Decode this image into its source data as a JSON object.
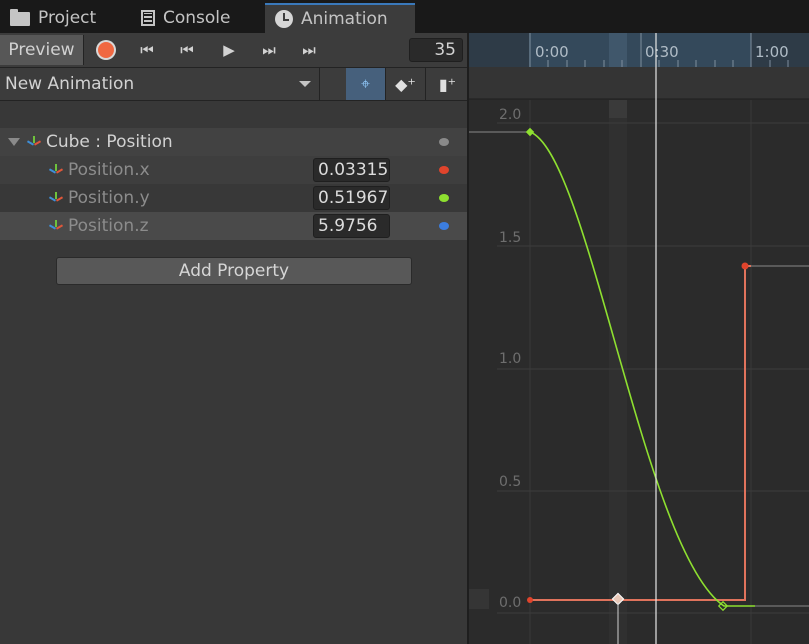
{
  "tabs": [
    {
      "label": "Project",
      "icon": "folder-icon"
    },
    {
      "label": "Console",
      "icon": "console-icon"
    },
    {
      "label": "Animation",
      "icon": "clock-icon"
    }
  ],
  "toolbar": {
    "preview_label": "Preview",
    "frame": "35"
  },
  "clip": {
    "name": "New Animation"
  },
  "properties": {
    "group": "Cube : Position",
    "items": [
      {
        "label": "Position.x",
        "value": "0.03315",
        "color": "#e0442c"
      },
      {
        "label": "Position.y",
        "value": "0.51967",
        "color": "#8ee030"
      },
      {
        "label": "Position.z",
        "value": "5.9756",
        "color": "#3c7ee0"
      }
    ],
    "add_label": "Add Property"
  },
  "timeline": {
    "ticks": [
      "0:00",
      "0:30",
      "1:00"
    ]
  },
  "curve_editor": {
    "y_labels": [
      "2.0",
      "1.5",
      "1.0",
      "0.5",
      "0.0"
    ],
    "colors": {
      "y_curve": "#8ee030",
      "x_curve": "#e0735c",
      "playhead": "#e6e6e6"
    }
  }
}
